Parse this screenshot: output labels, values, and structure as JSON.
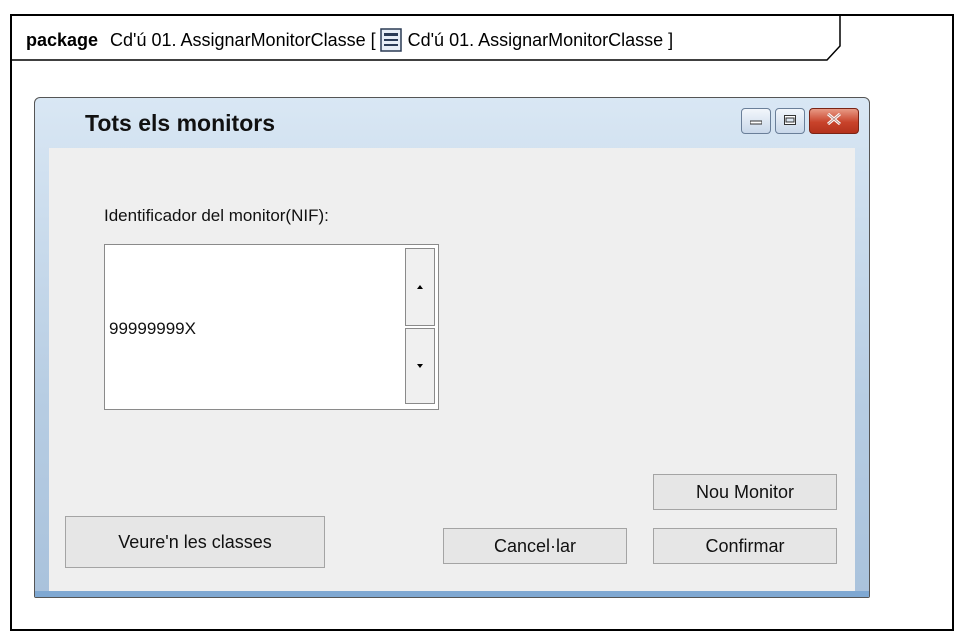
{
  "package": {
    "keyword": "package",
    "name": "Cd'ú 01. AssignarMonitorClasse [",
    "diagram_name": "Cd'ú 01. AssignarMonitorClasse ]",
    "icon": "diagram-icon"
  },
  "window": {
    "title": "Tots els monitors",
    "controls": [
      "minimize-icon",
      "maximize-icon",
      "close-icon"
    ]
  },
  "form": {
    "nif_label": "Identificador del monitor(NIF):",
    "nif_value": "99999999X"
  },
  "buttons": {
    "nou_monitor": "Nou Monitor",
    "veure_classes": "Veure'n les classes",
    "cancelar": "Cancel·lar",
    "confirmar": "Confirmar"
  }
}
